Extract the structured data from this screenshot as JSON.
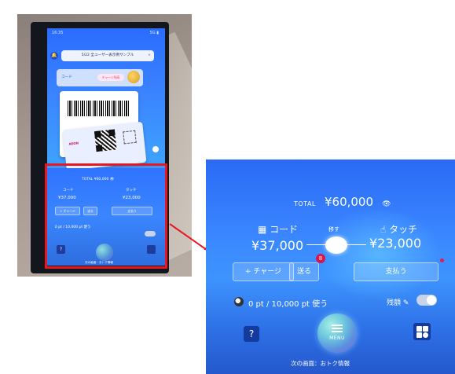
{
  "phone_photo": {
    "status_left": "16:35",
    "status_right": "5G ▮",
    "title_bar": "5/22 全ユーザー表示例サンプル",
    "title_close": "×",
    "card_top_code": "コード",
    "card_top_pill": "チャージ残高",
    "card_brand": "AEON",
    "panel_total": "TOTAL ¥60,000 👁",
    "panel_code": "コード",
    "panel_touch": "タッチ",
    "panel_code_amt": "¥37,000",
    "panel_touch_amt": "¥23,000",
    "panel_charge": "+ チャージ",
    "panel_send": "送る",
    "panel_pay": "支払う",
    "panel_points": "0 pt / 10,000 pt 使う",
    "panel_next": "次の画面：おトク情報",
    "help": "?"
  },
  "zoom": {
    "total_label": "TOTAL",
    "total_amount": "¥60,000",
    "eye_icon": "👁",
    "code_label": "コード",
    "touch_label": "タッチ",
    "code_amount": "¥37,000",
    "touch_amount": "¥23,000",
    "swap_label": "移す",
    "charge_button": "+ チャージ",
    "send_button": "送る",
    "send_badge": "8",
    "pay_button": "支払う",
    "points_text": "0 pt / 10,000 pt 使う",
    "hide_label": "残額 ✎",
    "help_button": "?",
    "menu_label": "MENU",
    "next_screen": "次の画面：おトク情報"
  },
  "colors": {
    "accent_blue": "#3a86ff",
    "highlight_red": "#e8171f",
    "badge_pink": "#d9154a"
  }
}
